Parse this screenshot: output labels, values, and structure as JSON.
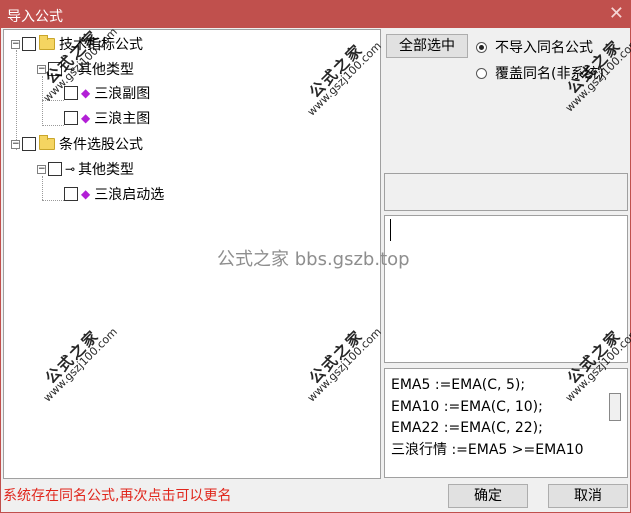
{
  "window": {
    "title": "导入公式",
    "close_glyph": "✕"
  },
  "tree": {
    "items": [
      {
        "label": "技术指标公式",
        "kind": "folder",
        "expander": "−"
      },
      {
        "label": "其他类型",
        "kind": "key",
        "expander": "−"
      },
      {
        "label": "三浪副图",
        "kind": "formula"
      },
      {
        "label": "三浪主图",
        "kind": "formula"
      },
      {
        "label": "条件选股公式",
        "kind": "folder",
        "expander": "−"
      },
      {
        "label": "其他类型",
        "kind": "key",
        "expander": "−"
      },
      {
        "label": "三浪启动选",
        "kind": "formula"
      }
    ]
  },
  "buttons": {
    "select_all": "全部选中",
    "ok": "确定",
    "cancel": "取消"
  },
  "radios": {
    "skip_same_name": "不导入同名公式",
    "overwrite_same_name": "覆盖同名(非系统)",
    "selected": "skip_same_name"
  },
  "code_lines": [
    "EMA5 :=EMA(C, 5);",
    "EMA10 :=EMA(C, 10);",
    "EMA22 :=EMA(C, 22);",
    "三浪行情 :=EMA5 >=EMA10"
  ],
  "status_text": "系统存在同名公式,再次点击可以更名",
  "watermark": {
    "center_text": "公式之家 bbs.gszb.top",
    "stamp_title": "公式之家",
    "stamp_url": "www.gszj100.com"
  },
  "colors": {
    "title_bar": "#c0504d",
    "status_text": "#e0261c",
    "formula_icon": "#b21fd6"
  }
}
